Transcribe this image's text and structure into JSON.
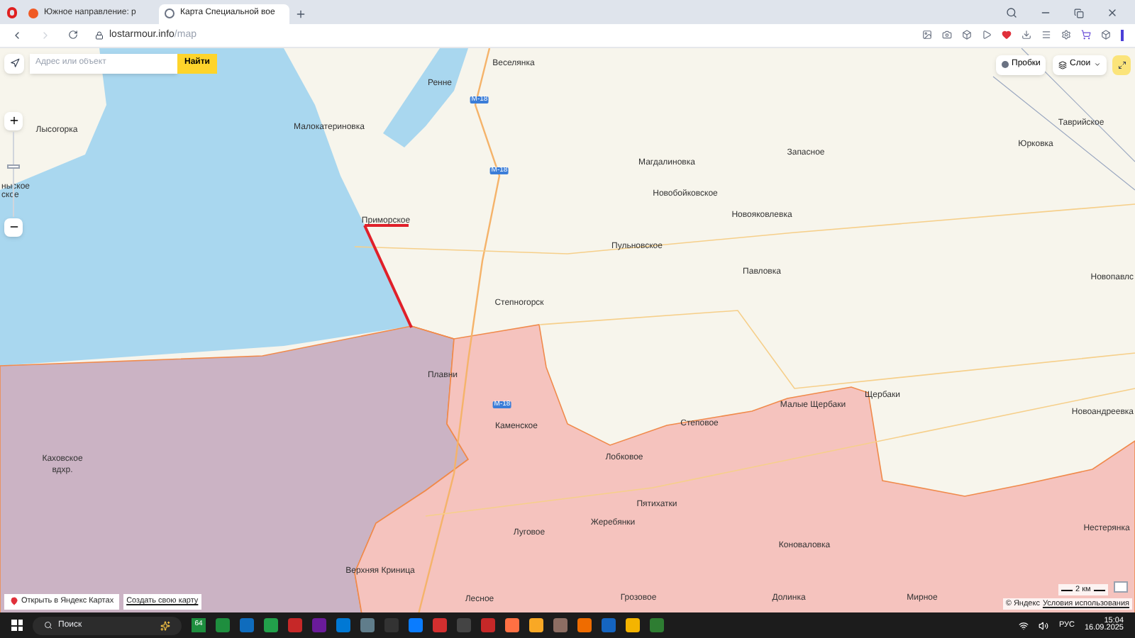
{
  "browser": {
    "tabs": [
      {
        "title": "Южное направление: р",
        "selected": false
      },
      {
        "title": "Карта Специальной вое",
        "selected": true
      }
    ],
    "url": {
      "host": "lostarmour.info",
      "path": "/map"
    }
  },
  "map": {
    "search": {
      "placeholder": "Адрес или объект",
      "button": "Найти"
    },
    "zoom": {
      "level": 0.58
    },
    "traffic_button": "Пробки",
    "layers_button": "Слои",
    "places": [
      "Веселянка",
      "Ренне",
      "Лысогорка",
      "Малокатериновка",
      "ныское",
      "ское",
      "Приморское",
      "Степногорск",
      "Магдалиновка",
      "Запасное",
      "Новобойковское",
      "Новояковлевка",
      "Пульновское",
      "Павловка",
      "Таврийское",
      "Юрковка",
      "Новопавлс",
      "Новоандреевка",
      "Малые Щербаки",
      "Щербаки",
      "Степовое",
      "Плавни",
      "Каменское",
      "Лобковое",
      "Пятихатки",
      "Жеребянки",
      "Луговое",
      "Коноваловка",
      "Нестерянка",
      "Каховское",
      "вдхр.",
      "Верхняя Криница",
      "Лесное",
      "Грозовое",
      "Долинка",
      "Мирное"
    ],
    "roads": [
      "М-18",
      "М-18",
      "М-18"
    ],
    "open_link": "Открыть в Яндекс Картах",
    "create_link": "Создать свою карту",
    "scale": "2 км",
    "copyright": "© Яндекс",
    "terms_link": "Условия использования"
  },
  "taskbar": {
    "search": "Поиск",
    "badge": "64",
    "language": "РУС",
    "time": "15:04",
    "date": "16.09.2025"
  }
}
